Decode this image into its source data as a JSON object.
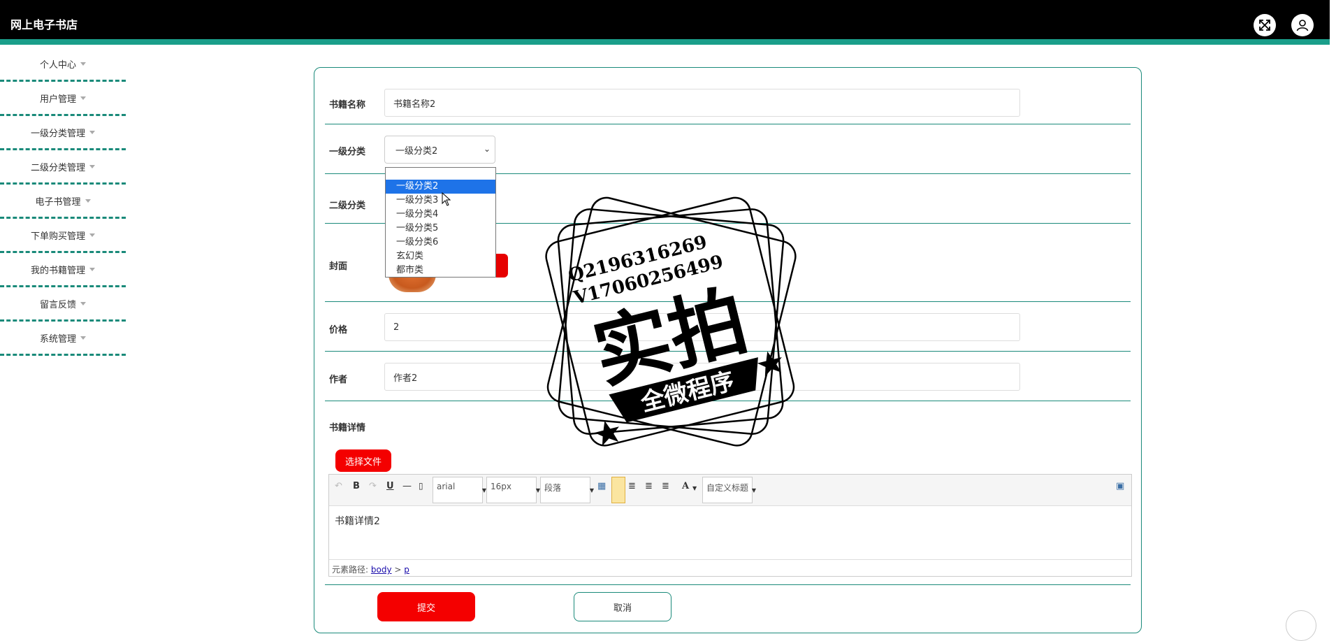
{
  "header": {
    "title": "网上电子书店",
    "fullscreen_icon": "expand-arrows-icon",
    "user_icon": "user-icon"
  },
  "sidebar": {
    "items": [
      {
        "label": "个人中心"
      },
      {
        "label": "用户管理"
      },
      {
        "label": "一级分类管理"
      },
      {
        "label": "二级分类管理"
      },
      {
        "label": "电子书管理"
      },
      {
        "label": "下单购买管理"
      },
      {
        "label": "我的书籍管理"
      },
      {
        "label": "留言反馈"
      },
      {
        "label": "系统管理"
      }
    ]
  },
  "form": {
    "book_name": {
      "label": "书籍名称",
      "value": "书籍名称2"
    },
    "category1": {
      "label": "一级分类",
      "value": "一级分类2",
      "options": [
        "一级分类2",
        "一级分类3",
        "一级分类4",
        "一级分类5",
        "一级分类6",
        "玄幻类",
        "都市类"
      ],
      "selected_index": 0
    },
    "category2": {
      "label": "二级分类"
    },
    "cover": {
      "label": "封面"
    },
    "price": {
      "label": "价格",
      "value": "2"
    },
    "author": {
      "label": "作者",
      "value": "作者2"
    },
    "details": {
      "label": "书籍详情",
      "choose_file": "选择文件"
    },
    "submit": "提交",
    "cancel": "取消"
  },
  "editor": {
    "font_family": "arial",
    "font_size": "16px",
    "paragraph": "段落",
    "custom_title": "自定义标题",
    "content": "书籍详情2",
    "path_label": "元素路径:",
    "path_body": "body",
    "path_sep": ">",
    "path_p": "p"
  },
  "watermark": {
    "line1": "Q2196316269",
    "line2": "V17060256499",
    "main": "实拍",
    "banner": "全微程序"
  },
  "colors": {
    "accent": "#1a9e8a",
    "danger": "#f40000",
    "selection": "#1e73e8"
  }
}
